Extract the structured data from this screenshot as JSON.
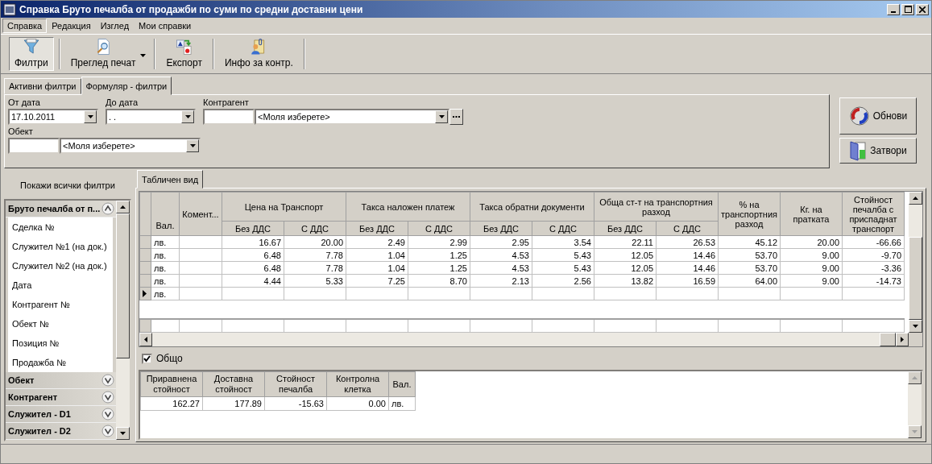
{
  "window": {
    "title": "Справка Бруто печалба от продажби по суми по средни доставни цени"
  },
  "menu": [
    {
      "label": "Справка",
      "selected": true
    },
    {
      "label": "Редакция",
      "selected": false
    },
    {
      "label": "Изглед",
      "selected": false
    },
    {
      "label": "Мои справки",
      "selected": false
    }
  ],
  "toolbar": [
    {
      "label": "Филтри",
      "kind": "filter",
      "pressed": true,
      "dropdown": false
    },
    {
      "label": "Преглед печат",
      "kind": "preview",
      "pressed": false,
      "dropdown": true
    },
    {
      "label": "Експорт",
      "kind": "export",
      "pressed": false,
      "dropdown": false
    },
    {
      "label": "Инфо за контр.",
      "kind": "info",
      "pressed": false,
      "dropdown": false
    }
  ],
  "filter_tabs": [
    {
      "label": "Активни филтри",
      "selected": false
    },
    {
      "label": "Формуляр - филтри",
      "selected": true
    }
  ],
  "filters": {
    "from_date": {
      "label": "От дата",
      "value": "17.10.2011"
    },
    "to_date": {
      "label": "До дата",
      "value": ". ."
    },
    "counterparty": {
      "label": "Контрагент",
      "placeholder": "<Моля изберете>"
    },
    "site": {
      "label": "Обект",
      "placeholder": "<Моля изберете>"
    }
  },
  "actions": [
    {
      "label": "Обнови",
      "kind": "refresh"
    },
    {
      "label": "Затвори",
      "kind": "close"
    }
  ],
  "sidebar": {
    "show_all": "Покажи всички филтри",
    "groups": [
      {
        "title": "Бруто печалба от п...",
        "expanded": true,
        "items": [
          "Сделка №",
          "Служител №1 (на док.)",
          "Служител №2 (на док.)",
          "Дата",
          "Контрагент №",
          "Обект №",
          "Позиция №",
          "Продажба №"
        ]
      },
      {
        "title": "Обект",
        "expanded": false
      },
      {
        "title": "Контрагент",
        "expanded": false
      },
      {
        "title": "Служител - D1",
        "expanded": false
      },
      {
        "title": "Служител - D2",
        "expanded": false
      }
    ]
  },
  "view_tabs": [
    {
      "label": "Табличен вид",
      "selected": true
    }
  ],
  "grid": {
    "columns": [
      {
        "label": "Вал."
      },
      {
        "label": "Комент..."
      },
      {
        "label": "Цена на Транспорт",
        "children": [
          "Без ДДС",
          "С ДДС"
        ]
      },
      {
        "label": "Такса наложен платеж",
        "children": [
          "Без ДДС",
          "С ДДС"
        ]
      },
      {
        "label": "Такса обратни документи",
        "children": [
          "Без ДДС",
          "С ДДС"
        ]
      },
      {
        "label": "Обща ст-т на транспортния разход",
        "children": [
          "Без ДДС",
          "С ДДС"
        ]
      },
      {
        "label": "% на транспортния разход"
      },
      {
        "label": "Кг. на пратката"
      },
      {
        "label": "Стойност печалба с приспаднат транспорт"
      }
    ],
    "rows": [
      {
        "currency": "лв.",
        "current": false,
        "values": [
          "16.67",
          "20.00",
          "2.49",
          "2.99",
          "2.95",
          "3.54",
          "22.11",
          "26.53",
          "45.12",
          "20.00",
          "-66.66"
        ]
      },
      {
        "currency": "лв.",
        "current": false,
        "values": [
          "6.48",
          "7.78",
          "1.04",
          "1.25",
          "4.53",
          "5.43",
          "12.05",
          "14.46",
          "53.70",
          "9.00",
          "-9.70"
        ]
      },
      {
        "currency": "лв.",
        "current": false,
        "values": [
          "6.48",
          "7.78",
          "1.04",
          "1.25",
          "4.53",
          "5.43",
          "12.05",
          "14.46",
          "53.70",
          "9.00",
          "-3.36"
        ]
      },
      {
        "currency": "лв.",
        "current": false,
        "values": [
          "4.44",
          "5.33",
          "7.25",
          "8.70",
          "2.13",
          "2.56",
          "13.82",
          "16.59",
          "64.00",
          "9.00",
          "-14.73"
        ]
      },
      {
        "currency": "лв.",
        "current": true,
        "values": []
      }
    ]
  },
  "totals": {
    "checkbox": {
      "label": "Общо",
      "checked": true
    },
    "columns": [
      "Приравнена стойност",
      "Доставна стойност",
      "Стойност печалба",
      "Контролна клетка",
      "Вал."
    ],
    "row": [
      "162.27",
      "177.89",
      "-15.63",
      "0.00",
      "лв."
    ]
  }
}
